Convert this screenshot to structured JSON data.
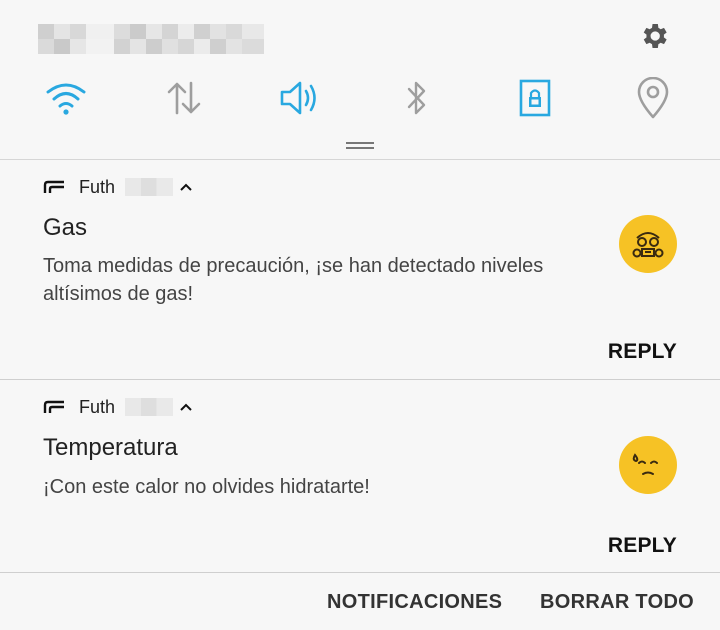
{
  "quick_settings": {
    "icons": [
      "wifi-icon",
      "mobile-data-icon",
      "sound-icon",
      "bluetooth-icon",
      "screen-rotation-lock-icon",
      "location-icon"
    ],
    "settings_icon": "gear-icon",
    "active_color": "#29a8e0",
    "inactive_color": "#9e9e9e"
  },
  "notifications": [
    {
      "app_name": "Futh",
      "title": "Gas",
      "text": "Toma medidas de precaución, ¡se han detectado niveles altísimos de gas!",
      "icon": "gas-mask-emoji-icon",
      "action_label": "REPLY"
    },
    {
      "app_name": "Futh",
      "title": "Temperatura",
      "text": "¡Con este calor no olvides hidratarte!",
      "icon": "sweating-face-emoji-icon",
      "action_label": "REPLY"
    }
  ],
  "footer": {
    "notifications_label": "NOTIFICACIONES",
    "clear_all_label": "BORRAR TODO"
  },
  "colors": {
    "emoji_yellow": "#f6c225",
    "background": "#f7f7f7"
  }
}
